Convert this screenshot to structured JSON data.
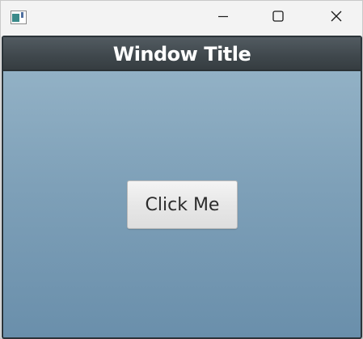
{
  "window": {
    "app_icon": "window-app-icon",
    "controls": {
      "minimize_icon": "minimize-icon",
      "maximize_icon": "maximize-icon",
      "close_icon": "close-icon"
    }
  },
  "header": {
    "title": "Window Title"
  },
  "main": {
    "button_label": "Click Me"
  },
  "colors": {
    "header_bg": "#3f474c",
    "content_gradient_top": "#98b6c9",
    "content_gradient_bottom": "#6a8fab",
    "button_bg": "#e6e6e6"
  }
}
